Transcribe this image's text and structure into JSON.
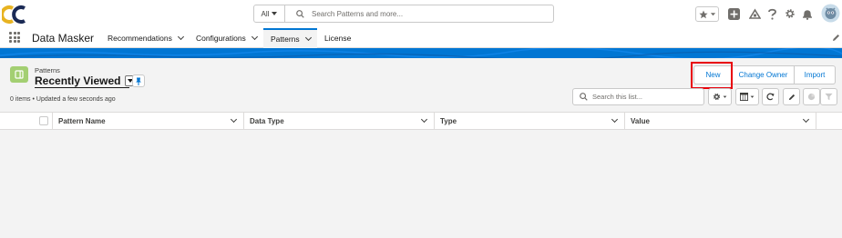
{
  "topbar": {
    "search_scope": "All",
    "search_placeholder": "Search Patterns and more..."
  },
  "nav": {
    "app_name": "Data Masker",
    "items": [
      {
        "label": "Recommendations",
        "has_menu": true
      },
      {
        "label": "Configurations",
        "has_menu": true
      },
      {
        "label": "Patterns",
        "has_menu": true,
        "active": true
      },
      {
        "label": "License",
        "has_menu": false
      }
    ]
  },
  "list_header": {
    "object_label": "Patterns",
    "view_name": "Recently Viewed",
    "meta": "0 items • Updated a few seconds ago"
  },
  "actions": {
    "new_label": "New",
    "change_owner_label": "Change Owner",
    "import_label": "Import"
  },
  "list_search": {
    "placeholder": "Search this list..."
  },
  "table": {
    "columns": [
      "Pattern Name",
      "Data Type",
      "Type",
      "Value"
    ],
    "rows": []
  },
  "colors": {
    "brand": "#0176d3",
    "object_icon": "#a3cf72",
    "highlight": "#e8000b"
  }
}
